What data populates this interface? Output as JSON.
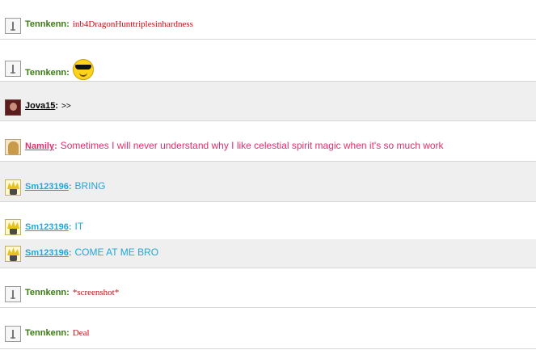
{
  "messages": [
    {
      "user": "Tennkenn",
      "text": "inb4DragonHunttriplesinhardness",
      "avatar": "blank-avatar-icon"
    },
    {
      "user": "Tennkenn",
      "text": "",
      "emoticon": "sunglasses-smiley-icon",
      "avatar": "blank-avatar-icon"
    },
    {
      "user": "Jova15",
      "text": ">>",
      "avatar": "user-photo-avatar"
    },
    {
      "user": "Namily",
      "text": "Sometimes I will never understand why I like celestial spirit magic when it's so much work",
      "avatar": "user-photo-avatar"
    },
    {
      "user": "Sm123196",
      "text": "BRING",
      "avatar": "anime-character-avatar"
    },
    {
      "user": "Sm123196",
      "text": "IT",
      "avatar": "anime-character-avatar"
    },
    {
      "user": "Sm123196",
      "text": "COME AT ME BRO",
      "avatar": "anime-character-avatar"
    },
    {
      "user": "Tennkenn",
      "text": "*screenshot*",
      "avatar": "blank-avatar-icon"
    },
    {
      "user": "Tennkenn",
      "text": "Deal",
      "avatar": "blank-avatar-icon"
    }
  ],
  "colors": {
    "tennkenn": "#3a7a10",
    "namily": "#e0306a",
    "sm123196": "#20a8d8",
    "message_red": "#c01010",
    "alt_row": "#efefef"
  }
}
